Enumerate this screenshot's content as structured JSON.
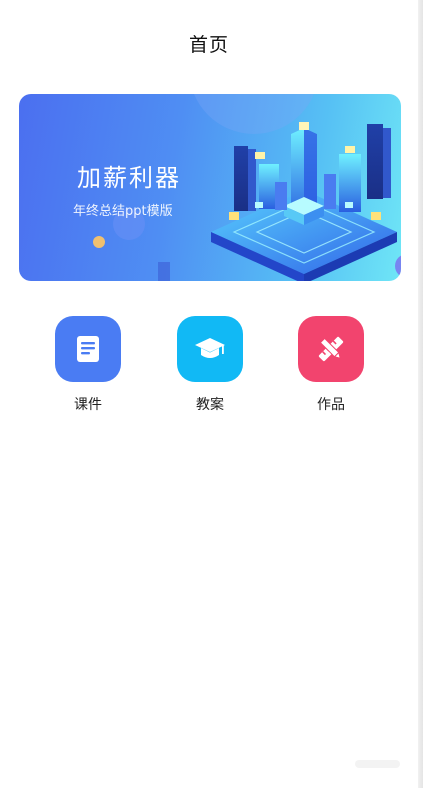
{
  "header": {
    "title": "首页"
  },
  "banner": {
    "title": "加薪利器",
    "subtitle": "年终总结ppt模版"
  },
  "quick_nav": [
    {
      "label": "课件",
      "icon": "document-icon",
      "color": "#4a7cf3"
    },
    {
      "label": "教案",
      "icon": "graduation-cap-icon",
      "color": "#11b9f5"
    },
    {
      "label": "作品",
      "icon": "pencil-ruler-icon",
      "color": "#f2446e"
    }
  ],
  "colors": {
    "banner_gradient_start": "#4b6ff0",
    "banner_gradient_end": "#6fe6f6"
  }
}
